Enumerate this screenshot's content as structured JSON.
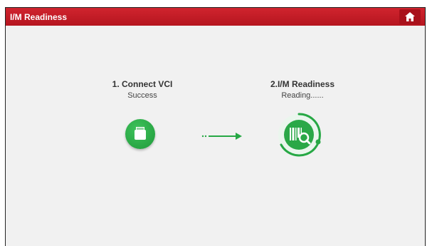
{
  "header": {
    "title": "I/M Readiness"
  },
  "steps": [
    {
      "title": "1. Connect VCI",
      "status": "Success"
    },
    {
      "title": "2.I/M Readiness",
      "status": "Reading......"
    }
  ],
  "icons": {
    "home": "home-icon",
    "connect": "vci-connector-icon",
    "arrow": "arrow-right-icon",
    "readiness": "readiness-scan-icon"
  },
  "colors": {
    "header_red": "#c41a24",
    "accent_green": "#27a845",
    "background": "#f1f1f1"
  }
}
